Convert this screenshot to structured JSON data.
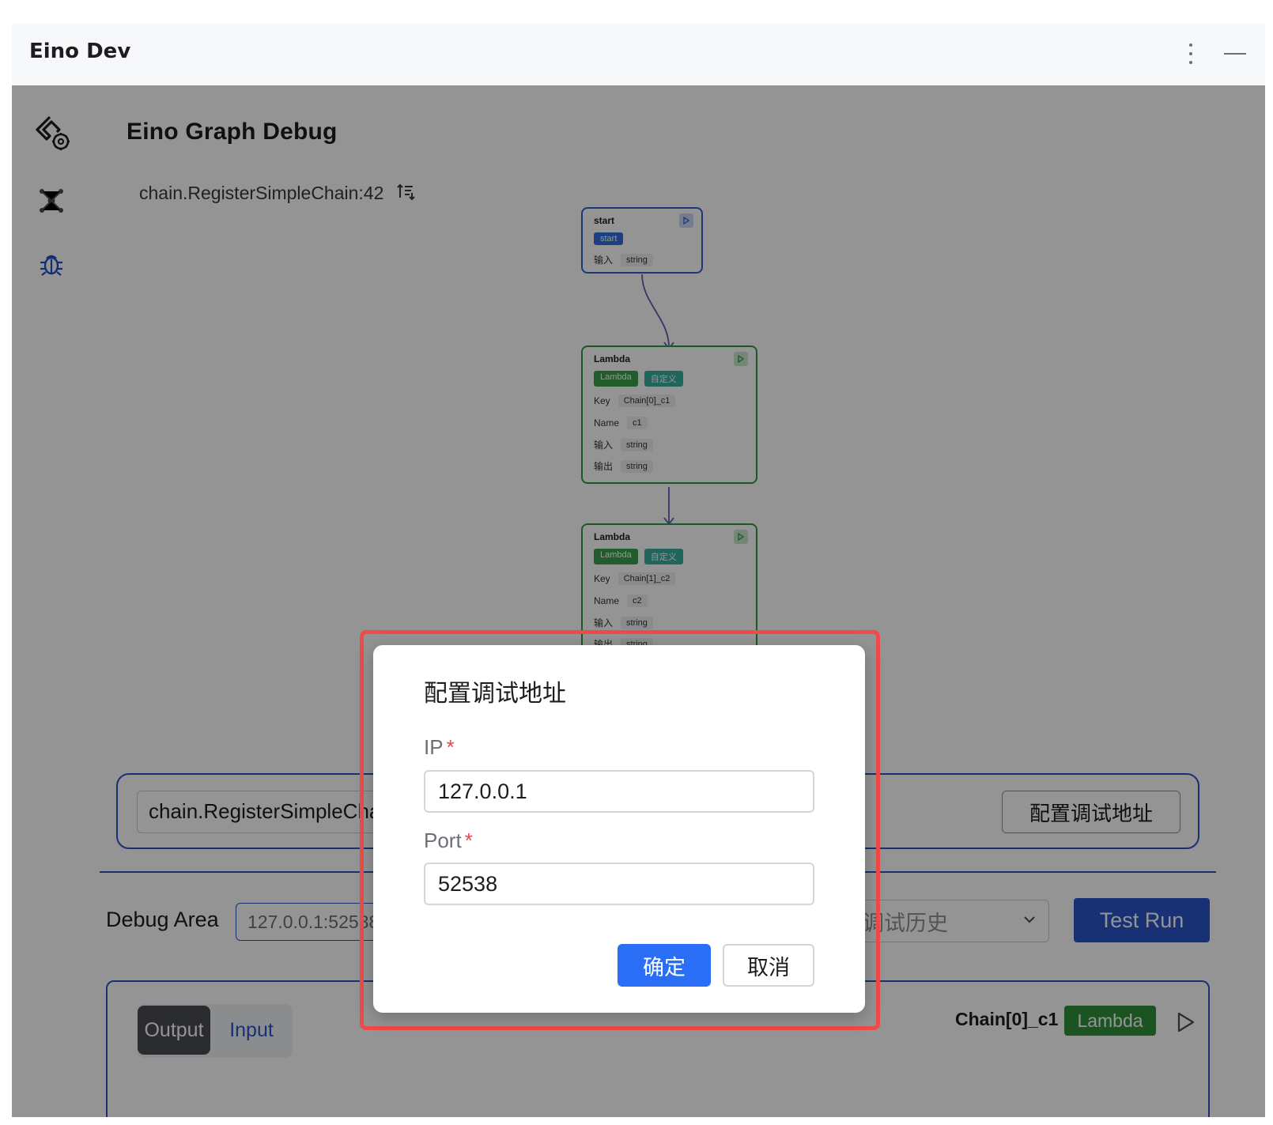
{
  "window": {
    "title": "Eino Dev"
  },
  "sidebar": {
    "items": [
      {
        "icon": "plugin-settings-icon"
      },
      {
        "icon": "graph-nodes-icon"
      },
      {
        "icon": "bug-icon"
      }
    ]
  },
  "page": {
    "title": "Eino Graph Debug",
    "graph_name": "chain.RegisterSimpleChain:42"
  },
  "graph": {
    "nodes": [
      {
        "head": "start",
        "tags": [
          "start"
        ],
        "rows": [
          {
            "k": "输入",
            "v": "string"
          }
        ]
      },
      {
        "head": "Lambda",
        "tags": [
          "Lambda",
          "自定义"
        ],
        "rows": [
          {
            "k": "Key",
            "v": "Chain[0]_c1"
          },
          {
            "k": "Name",
            "v": "c1"
          },
          {
            "k": "输入",
            "v": "string"
          },
          {
            "k": "输出",
            "v": "string"
          }
        ]
      },
      {
        "head": "Lambda",
        "tags": [
          "Lambda",
          "自定义"
        ],
        "rows": [
          {
            "k": "Key",
            "v": "Chain[1]_c2"
          },
          {
            "k": "Name",
            "v": "c2"
          },
          {
            "k": "输入",
            "v": "string"
          },
          {
            "k": "输出",
            "v": "string"
          }
        ]
      }
    ]
  },
  "chain_bar": {
    "selected": "chain.RegisterSimpleChain:42",
    "config_button": "配置调试地址"
  },
  "debug": {
    "label": "Debug Area",
    "address": "127.0.0.1:52538",
    "history_placeholder": "查看调试历史",
    "test_run": "Test Run"
  },
  "output_panel": {
    "tab_output": "Output",
    "tab_input": "Input",
    "node_key": "Chain[0]_c1",
    "node_type": "Lambda"
  },
  "dialog": {
    "title": "配置调试地址",
    "ip_label": "IP",
    "ip_value": "127.0.0.1",
    "port_label": "Port",
    "port_value": "52538",
    "required_mark": "*",
    "ok": "确定",
    "cancel": "取消"
  },
  "colors": {
    "accent": "#2a55c9",
    "primary_button": "#2a6ef5",
    "highlight": "#f04a4a",
    "lambda_green": "#2f8f3a",
    "tag_teal": "#3ab09e"
  }
}
